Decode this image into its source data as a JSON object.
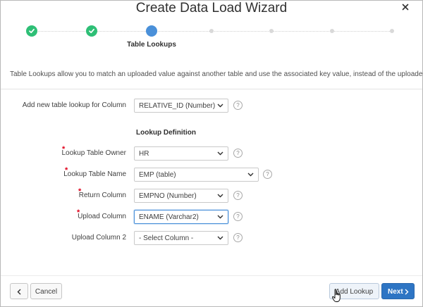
{
  "dialog": {
    "title": "Create Data Load Wizard",
    "close_icon": "close-icon"
  },
  "wizard": {
    "steps": [
      {
        "state": "complete"
      },
      {
        "state": "complete"
      },
      {
        "state": "current",
        "label": "Table Lookups"
      },
      {
        "state": "future"
      },
      {
        "state": "future"
      },
      {
        "state": "future"
      },
      {
        "state": "future"
      }
    ],
    "current_label": "Table Lookups",
    "complete_color": "#2ebf76",
    "current_color": "#4a90d9"
  },
  "description": "Table Lookups allow you to match an uploaded value against another table and use the associated key value, instead of the uploaded value.",
  "form": {
    "add_lookup_column": {
      "label": "Add new table lookup for Column",
      "value": "RELATIVE_ID (Number)"
    },
    "section_title": "Lookup Definition",
    "lookup_table_owner": {
      "label": "Lookup Table Owner",
      "value": "HR",
      "required": true
    },
    "lookup_table_name": {
      "label": "Lookup Table Name",
      "value": "EMP (table)",
      "required": true
    },
    "return_column": {
      "label": "Return Column",
      "value": "EMPNO (Number)",
      "required": true
    },
    "upload_column": {
      "label": "Upload Column",
      "value": "ENAME (Varchar2)",
      "required": true
    },
    "upload_column_2": {
      "label": "Upload Column 2",
      "value": "- Select Column -"
    },
    "help_glyph": "?",
    "required_glyph": "*"
  },
  "footer": {
    "cancel_label": "Cancel",
    "add_lookup_label": "Add Lookup",
    "next_label": "Next",
    "primary_color": "#2e75c4"
  }
}
